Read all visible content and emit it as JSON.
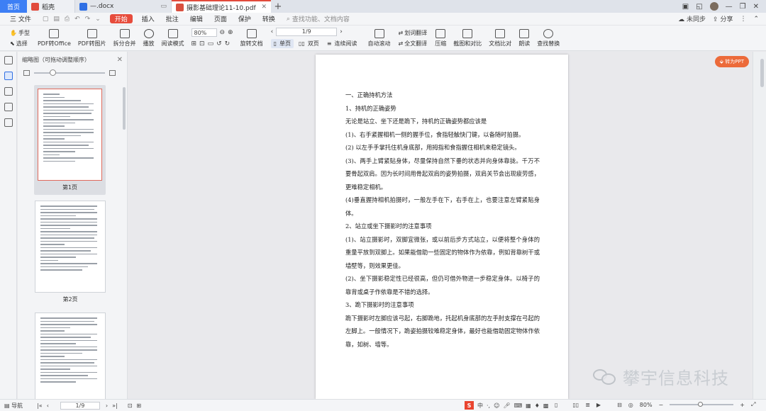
{
  "tabs": {
    "home": "首页",
    "doc": "稻壳",
    "docx": "—.docx",
    "pdf": "摄影基础理论11-10.pdf",
    "add": "+"
  },
  "menu": {
    "file": "三 文件",
    "items": [
      "开始",
      "插入",
      "批注",
      "编辑",
      "页面",
      "保护",
      "转换"
    ],
    "search": "查找功能、文档内容",
    "right": [
      "未同步",
      "分享"
    ]
  },
  "ribbon": {
    "hand": "手型",
    "select": "选择",
    "pdf_to_office": "PDF转Office",
    "pdf_to_image": "PDF转图片",
    "split_merge": "拆分合并",
    "play": "播放",
    "read_mode": "阅读模式",
    "zoom": "80%",
    "rotate": "旋转文档",
    "page": "1/9",
    "single": "单页",
    "double": "双页",
    "continuous": "连续阅读",
    "auto_scroll": "自动滚动",
    "translate_phrase": "划词翻译",
    "translate_full": "全文翻译",
    "compress": "压缩",
    "screenshot": "截图和对比",
    "doc_compare": "文档比对",
    "read_aloud": "朗读",
    "find_replace": "查找替换"
  },
  "sidebar": {
    "panel_title": "缩略图（可拖动调整顺序）",
    "thumbs": [
      "第1页",
      "第2页"
    ]
  },
  "doc": {
    "to_ppt": "转为PPT",
    "paragraphs": [
      "一、正确持机方法",
      "1、持机的正确姿势",
      "无论是站立、坐下还是跪下，持机的正确姿势都应该是",
      "(1)、右手紧握相机一侧的握手位，食指轻触快门键，以备随时拍摄。",
      "(2) 以左手手掌托住机身底部，用拇指和食指握住相机来稳定镜头。",
      "(3)、两手上臂紧贴身体，尽量保持自然下垂的状态并向身体靠拢。千万不要骨起双肩。因为长时间用骨起双肩的姿势拍摄，双肩关节会出现疲劳感，更难稳定相机。",
      "(4)垂直握持相机拍摄时，一般左手在下，右手在上，也要注意左臂紧贴身体。",
      "2、站立或坐下摄影时的注意事项",
      "(1)、站立摄影时，双脚宜微张，或以前后步方式站立，以便将整个身体的重量平放到双脚上。如果能借助一些固定的物体作为依靠，例如背靠树干或墙壁等，则效果更佳。",
      "(2)、坐下摄影稳定性已经很高，但仍可借外物进一步稳定身体。以椅子的靠背或桌子作依靠是不错的选择。",
      "3、跪下摄影时的注意事项",
      "跪下摄影时左脚应该弓起，右脚跪地，托起机身底部的左手肘支撑在弓起的左脚上。一般情况下，跪姿拍摄较难稳定身体，最好也能借助固定物体作依靠，如树、墙等。"
    ]
  },
  "watermark": {
    "text": "攀宇信息科技"
  },
  "status": {
    "nav": "导航",
    "page": "1/9",
    "zoom": "80%",
    "ime": "中"
  }
}
